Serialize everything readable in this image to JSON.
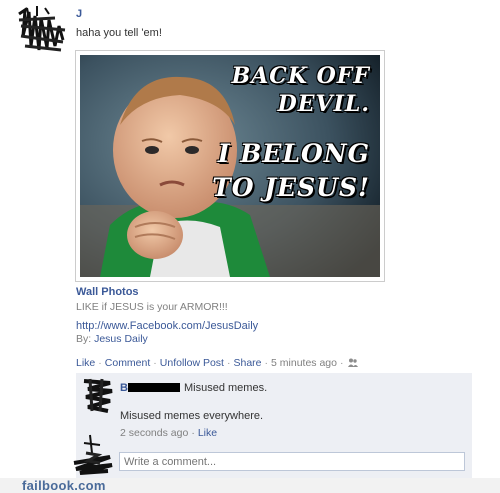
{
  "post": {
    "author": "J",
    "text": "haha you tell 'em!",
    "photo": {
      "meme_lines": [
        "BACK OFF",
        "DEVIL.",
        "I BELONG",
        "TO JESUS!"
      ]
    },
    "album_title": "Wall Photos",
    "caption": "LIKE if JESUS is your ARMOR!!!",
    "link_url": "http://www.Facebook.com/JesusDaily",
    "by_label": "By:",
    "by_name": "Jesus Daily"
  },
  "actions": {
    "like": "Like",
    "comment": "Comment",
    "unfollow": "Unfollow Post",
    "share": "Share",
    "time": "5 minutes ago"
  },
  "comment": {
    "name_initial": "B",
    "inline_text": "Misused memes.",
    "body": "Misused memes everywhere.",
    "time": "2 seconds ago",
    "like": "Like"
  },
  "write_comment": {
    "placeholder": "Write a comment..."
  },
  "watermark": "failbook.com",
  "colors": {
    "link": "#3b5998",
    "comment_bg": "#edeff4",
    "meta": "#808080"
  }
}
